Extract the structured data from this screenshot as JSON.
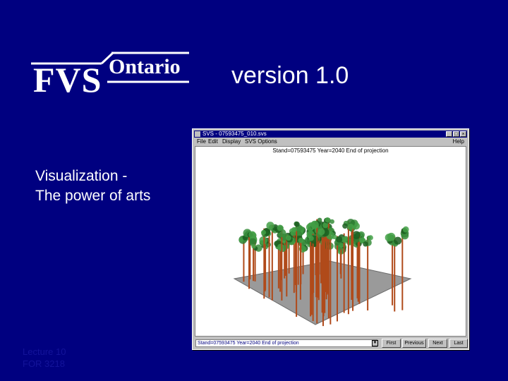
{
  "logo": {
    "fvs": "FVS",
    "ontario": "Ontario"
  },
  "version_text": "version 1.0",
  "subtitle": [
    "Visualization -",
    "The power of arts"
  ],
  "footer": [
    "Lecture 10",
    "FOR 3218"
  ],
  "window": {
    "title": "SVS - 07593475_010.svs",
    "menu": [
      "File",
      "Edit",
      "Display",
      "SVS Options",
      "Help"
    ],
    "status": "Stand=07593475 Year=2040 End of projection",
    "combo_value": "Stand=07593475 Year=2040 End of projection",
    "buttons": {
      "first": "First",
      "previous": "Previous",
      "next": "Next",
      "last": "Last"
    },
    "controls": {
      "minimize": "_",
      "maximize": "□",
      "close": "×"
    }
  }
}
